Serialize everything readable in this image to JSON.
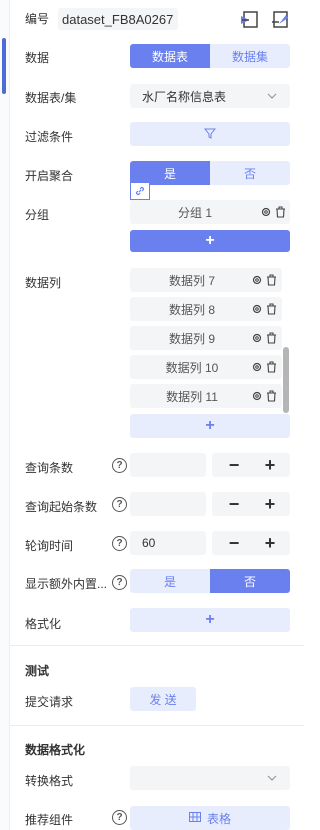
{
  "header": {
    "id_label": "编号",
    "id_value": "dataset_FB8A0267"
  },
  "data_source": {
    "label": "数据",
    "options": [
      "数据表",
      "数据集"
    ],
    "selected": "数据表"
  },
  "table_select": {
    "label": "数据表/集",
    "value": "水厂名称信息表"
  },
  "filter": {
    "label": "过滤条件"
  },
  "aggregate": {
    "label": "开启聚合",
    "options": [
      "是",
      "否"
    ],
    "selected": "是"
  },
  "group": {
    "label": "分组",
    "items": [
      "分组 1"
    ]
  },
  "columns": {
    "label": "数据列",
    "items": [
      "数据列 7",
      "数据列 8",
      "数据列 9",
      "数据列 10",
      "数据列 11"
    ]
  },
  "query_count": {
    "label": "查询条数",
    "value": "",
    "minus": "−",
    "plus": "+"
  },
  "query_start": {
    "label": "查询起始条数",
    "value": "",
    "minus": "−",
    "plus": "+"
  },
  "poll_time": {
    "label": "轮询时间",
    "value": "60",
    "minus": "−",
    "plus": "+"
  },
  "extra_builtin": {
    "label": "显示额外内置...",
    "options": [
      "是",
      "否"
    ],
    "selected": "否"
  },
  "format": {
    "label": "格式化"
  },
  "test_section": {
    "title": "测试",
    "submit_label": "提交请求",
    "send_button": "发 送"
  },
  "data_format_section": {
    "title": "数据格式化",
    "convert_label": "转换格式",
    "convert_value": "",
    "recommend_label": "推荐组件",
    "recommend_value": "表格"
  },
  "colors": {
    "accent": "#6a80ee",
    "accent_light": "#e8edfd",
    "field_bg": "#f4f5f7"
  }
}
